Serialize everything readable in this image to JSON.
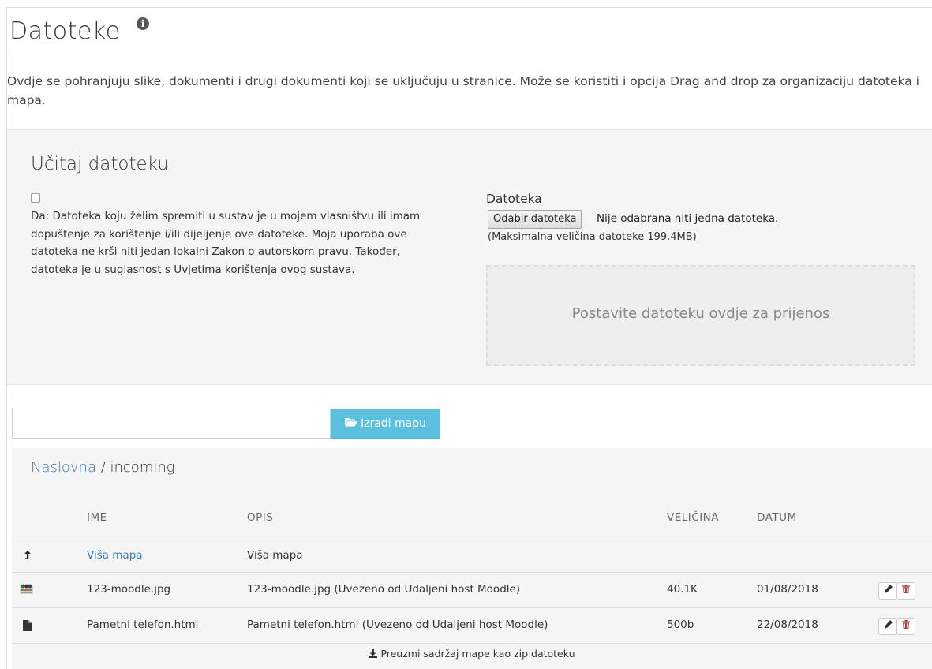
{
  "page": {
    "title": "Datoteke",
    "description": "Ovdje se pohranjuju slike, dokumenti i drugi dokumenti koji se uključuju u stranice. Može se koristiti i opcija Drag and drop za organizaciju datoteka i mapa."
  },
  "upload": {
    "title": "Učitaj datoteku",
    "terms": "Da: Datoteka koju želim spremiti u sustav je u mojem vlasništvu ili imam dopuštenje za korištenje i/ili dijeljenje ove datoteke. Moja uporaba ove datoteka ne krši niti jedan lokalni Zakon o autorskom pravu. Također, datoteka je u suglasnost s Uvjetima korištenja ovog sustava.",
    "file_label": "Datoteka",
    "choose_button": "Odabir datoteka",
    "no_file": "Nije odabrana niti jedna datoteka.",
    "max_size": "(Maksimalna veličina datoteke 199.4MB)",
    "dropzone": "Postavite datoteku ovdje za prijenos"
  },
  "folder": {
    "input_value": "",
    "create_button": "Izradi mapu"
  },
  "breadcrumb": {
    "home": "Naslovna",
    "separator": " / ",
    "current": "incoming"
  },
  "table": {
    "headers": {
      "name": "IME",
      "description": "OPIS",
      "size": "VELIČINA",
      "date": "DATUM"
    },
    "parent": {
      "name": "Viša mapa",
      "description": "Viša mapa"
    },
    "rows": [
      {
        "name": "123-moodle.jpg",
        "description": "123-moodle.jpg (Uvezeno od Udaljeni host Moodle)",
        "size": "40.1K",
        "date": "01/08/2018",
        "icon": "image-thumbnail-icon"
      },
      {
        "name": "Pametni telefon.html",
        "description": "Pametni telefon.html (Uvezeno od Udaljeni host Moodle)",
        "size": "500b",
        "date": "22/08/2018",
        "icon": "file-icon"
      }
    ],
    "zip_link": "Preuzmi sadržaj mape kao zip datoteku"
  },
  "colors": {
    "accent_button": "#5bc0de",
    "link": "#3a7bbf",
    "delete": "#a94442",
    "panel_bg": "#f5f5f5"
  }
}
